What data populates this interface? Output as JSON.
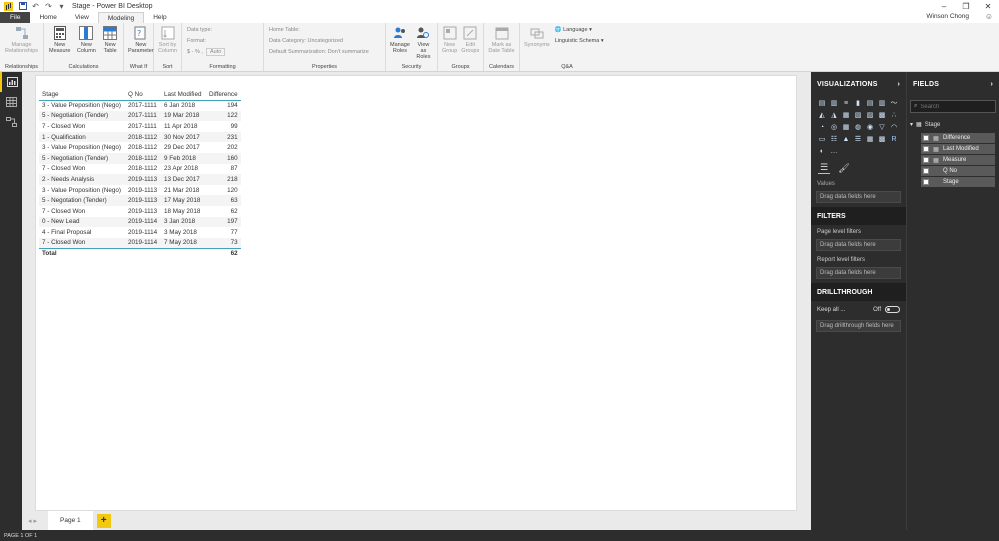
{
  "window": {
    "title": "Stage - Power BI Desktop",
    "user": "Winson Chong"
  },
  "tabs": [
    "File",
    "Home",
    "View",
    "Modeling",
    "Help"
  ],
  "active_tab": "Modeling",
  "ribbon": {
    "relationships": {
      "manage": "Manage Relationships",
      "group": "Relationships"
    },
    "calculations": {
      "new_measure": "New Measure",
      "new_column": "New Column",
      "new_table": "New Table",
      "group": "Calculations"
    },
    "whatif": {
      "new_parameter": "New Parameter",
      "group": "What If"
    },
    "sort": {
      "sort_by_column": "Sort by Column",
      "group": "Sort"
    },
    "formatting": {
      "data_type": "Data type:",
      "format": "Format:",
      "currency": "$ - % ,",
      "auto": "Auto",
      "group": "Formatting"
    },
    "properties": {
      "home_table": "Home Table:",
      "data_category": "Data Category: Uncategorized",
      "default_summarization": "Default Summarization: Don't summarize",
      "group": "Properties"
    },
    "security": {
      "manage_roles": "Manage Roles",
      "view_as_roles": "View as Roles",
      "group": "Security"
    },
    "groups": {
      "new_group": "New Group",
      "edit_groups": "Edit Groups",
      "group": "Groups"
    },
    "calendars": {
      "mark_as_date_table": "Mark as Date Table",
      "group": "Calendars"
    },
    "qa": {
      "synonyms": "Synonyms",
      "language": "Language",
      "linguistic_schema": "Linguistic Schema",
      "group": "Q&A"
    }
  },
  "table_visual": {
    "headers": [
      "Stage",
      "Q No",
      "Last Modified",
      "Difference"
    ],
    "rows": [
      [
        "3 - Value Preposition (Nego)",
        "2017-1111",
        "6 Jan 2018",
        "194"
      ],
      [
        "5 - Negotiation (Tender)",
        "2017-1111",
        "19 Mar 2018",
        "122"
      ],
      [
        "7 - Closed Won",
        "2017-1111",
        "11 Apr 2018",
        "99"
      ],
      [
        "1 - Qualification",
        "2018-1112",
        "30 Nov 2017",
        "231"
      ],
      [
        "3 - Value Proposition (Nego)",
        "2018-1112",
        "29 Dec 2017",
        "202"
      ],
      [
        "5 - Negotiation (Tender)",
        "2018-1112",
        "9 Feb 2018",
        "160"
      ],
      [
        "7 - Closed Won",
        "2018-1112",
        "23 Apr 2018",
        "87"
      ],
      [
        "2 - Needs Analysis",
        "2019-1113",
        "13 Dec 2017",
        "218"
      ],
      [
        "3 - Value Proposition (Nego)",
        "2019-1113",
        "21 Mar 2018",
        "120"
      ],
      [
        "5 - Negotation (Tender)",
        "2019-1113",
        "17 May 2018",
        "63"
      ],
      [
        "7 - Closed Won",
        "2019-1113",
        "18 May 2018",
        "62"
      ],
      [
        "0 - New Lead",
        "2019-1114",
        "3 Jan 2018",
        "197"
      ],
      [
        "4 - Final Proposal",
        "2019-1114",
        "3 May 2018",
        "77"
      ],
      [
        "7 - Closed Won",
        "2019-1114",
        "7 May 2018",
        "73"
      ]
    ],
    "total_label": "Total",
    "total_value": "62"
  },
  "pages": {
    "tab": "Page 1",
    "add": "+",
    "status": "PAGE 1 OF 1"
  },
  "visualizations": {
    "title": "VISUALIZATIONS",
    "values_label": "Values",
    "drop_here": "Drag data fields here"
  },
  "filters": {
    "title": "FILTERS",
    "page_level": "Page level filters",
    "report_level": "Report level filters",
    "drop_here": "Drag data fields here"
  },
  "drillthrough": {
    "title": "DRILLTHROUGH",
    "keep_all": "Keep all ...",
    "toggle_state": "Off",
    "drop_here": "Drag drillthrough fields here"
  },
  "fields": {
    "title": "FIELDS",
    "search_placeholder": "Search",
    "table_name": "Stage",
    "items": [
      "Difference",
      "Last Modified",
      "Measure",
      "Q No",
      "Stage"
    ]
  },
  "colors": {
    "accent": "#f2c811",
    "table_rule": "#41a1b8",
    "pane_bg": "#2d2d2d"
  }
}
